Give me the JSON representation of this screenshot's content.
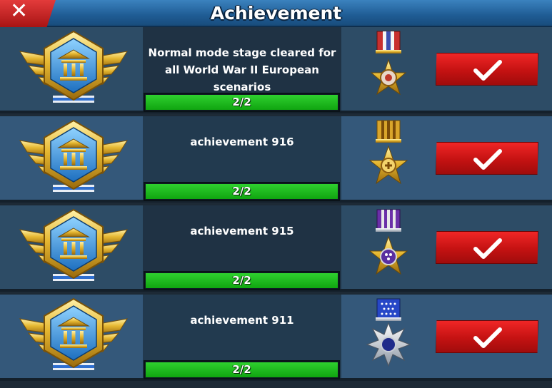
{
  "header": {
    "title": "Achievement",
    "close_icon": "close-icon"
  },
  "achievements": [
    {
      "description": "Normal mode stage cleared for all World War II European scenarios",
      "progress_text": "2/2",
      "progress_fraction": 1.0,
      "medal": "silver-star-medal",
      "claim_icon": "check-icon"
    },
    {
      "description": "achievement 916",
      "progress_text": "2/2",
      "progress_fraction": 1.0,
      "medal": "gold-cross-medal",
      "claim_icon": "check-icon"
    },
    {
      "description": "achievement 915",
      "progress_text": "2/2",
      "progress_fraction": 1.0,
      "medal": "purple-star-medal",
      "claim_icon": "check-icon"
    },
    {
      "description": "achievement 911",
      "progress_text": "2/2",
      "progress_fraction": 1.0,
      "medal": "blue-silver-star-medal",
      "claim_icon": "check-icon"
    }
  ],
  "colors": {
    "progress_fill": "#1fc21f",
    "claim_button": "#d61a1a",
    "header": "#2a6fae"
  }
}
